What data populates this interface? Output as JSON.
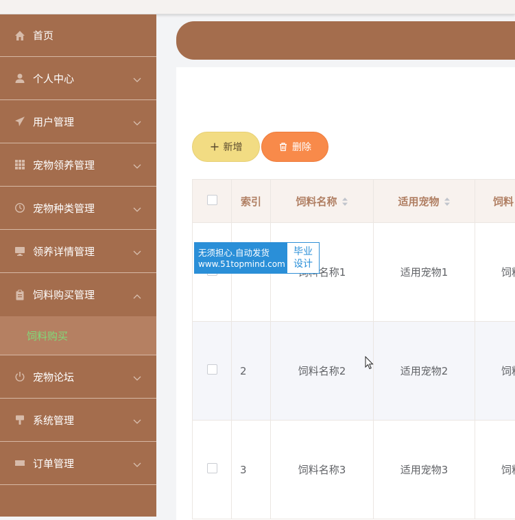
{
  "sidebar": {
    "items": [
      {
        "label": "首页",
        "icon": "home-icon"
      },
      {
        "label": "个人中心",
        "icon": "user-icon"
      },
      {
        "label": "用户管理",
        "icon": "send-icon"
      },
      {
        "label": "宠物领养管理",
        "icon": "grid-icon"
      },
      {
        "label": "宠物种类管理",
        "icon": "clock-icon"
      },
      {
        "label": "领养详情管理",
        "icon": "monitor-icon"
      },
      {
        "label": "饲料购买管理",
        "icon": "clipboard-icon"
      },
      {
        "label": "宠物论坛",
        "icon": "power-icon"
      },
      {
        "label": "系统管理",
        "icon": "brush-icon"
      },
      {
        "label": "订单管理",
        "icon": "ticket-icon"
      }
    ],
    "submenu": {
      "label": "饲料购买"
    }
  },
  "toolbar": {
    "add_label": "新增",
    "delete_label": "删除"
  },
  "table": {
    "headers": [
      "索引",
      "饲料名称",
      "适用宠物",
      "饲料"
    ],
    "rows": [
      {
        "index": "",
        "name": "饲料名称1",
        "pet": "适用宠物1",
        "extra": "饲料"
      },
      {
        "index": "2",
        "name": "饲料名称2",
        "pet": "适用宠物2",
        "extra": "饲料"
      },
      {
        "index": "3",
        "name": "饲料名称3",
        "pet": "适用宠物3",
        "extra": "饲料"
      }
    ]
  },
  "watermark": {
    "line1": "无须担心.自动发货",
    "line2": "www.51topmind.com",
    "side1": "毕业",
    "side2": "设计"
  },
  "colors": {
    "sidebar": "#a46d4d",
    "submenu_text": "#7fdc7a",
    "add_button": "#f2dc83",
    "delete_button": "#f88a4a",
    "header_text": "#b07f63"
  }
}
